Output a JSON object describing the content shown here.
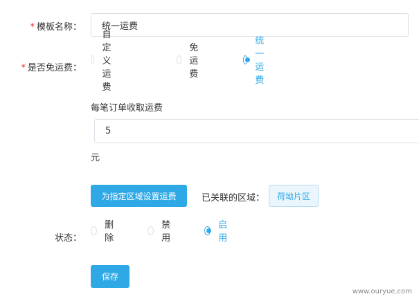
{
  "template_name": {
    "label": "模板名称：",
    "required_mark": "*",
    "value": "统一运费"
  },
  "free_shipping": {
    "label": "是否免运费：",
    "required_mark": "*",
    "options": [
      {
        "label": "自定义运费",
        "checked": false
      },
      {
        "label": "免运费",
        "checked": false
      },
      {
        "label": "统一运费",
        "checked": true
      }
    ]
  },
  "fee": {
    "label": "每笔订单收取运费",
    "value": "5",
    "unit": "元"
  },
  "region": {
    "button_label": "为指定区域设置运费",
    "linked_label": "已关联的区域：",
    "linked_tag": "荷坳片区"
  },
  "status": {
    "label": "状态：",
    "options": [
      {
        "label": "删除",
        "checked": false
      },
      {
        "label": "禁用",
        "checked": false
      },
      {
        "label": "启用",
        "checked": true
      }
    ]
  },
  "save_label": "保存",
  "watermark": "www.ouryue.com",
  "accent_color": "#2fa8e6"
}
